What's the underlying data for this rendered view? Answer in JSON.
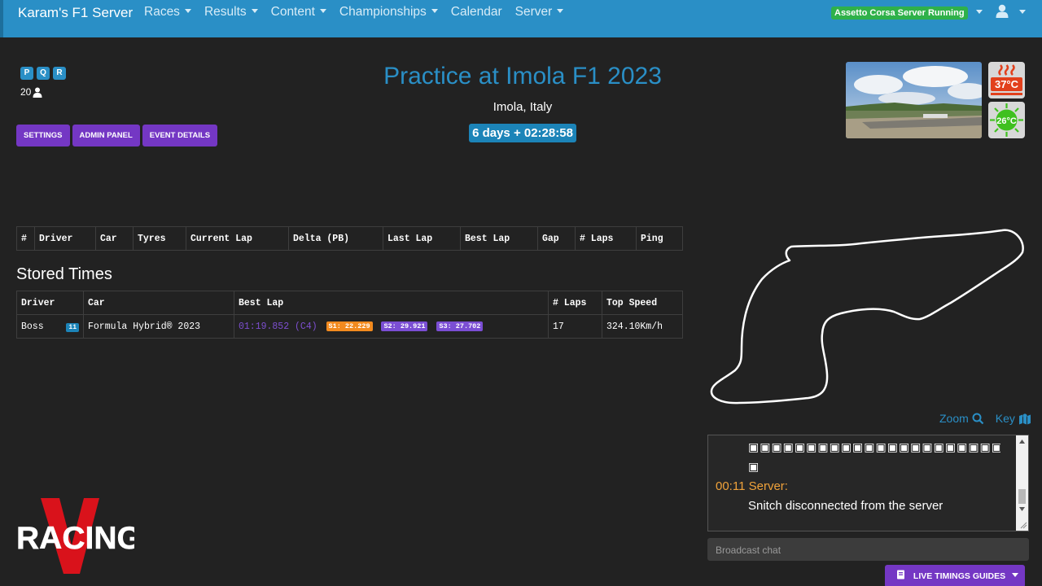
{
  "nav": {
    "brand": "Karam's F1 Server",
    "items": [
      "Races",
      "Results",
      "Content",
      "Championships",
      "Calendar",
      "Server"
    ],
    "dropdown_items": [
      true,
      true,
      true,
      true,
      false,
      true
    ],
    "status": "Assetto Corsa Server Running"
  },
  "session": {
    "badges": [
      "P",
      "Q",
      "R"
    ],
    "driver_count": "20",
    "buttons": [
      "SETTINGS",
      "ADMIN PANEL",
      "EVENT DETAILS"
    ]
  },
  "event": {
    "title": "Practice at Imola F1 2023",
    "location": "Imola, Italy",
    "countdown": "6 days + 02:28:58",
    "road_temp": "37°C",
    "ambient_temp": "26°C"
  },
  "live_table": {
    "headers": [
      "#",
      "Driver",
      "Car",
      "Tyres",
      "Current Lap",
      "Delta (PB)",
      "Last Lap",
      "Best Lap",
      "Gap",
      "# Laps",
      "Ping"
    ]
  },
  "stored": {
    "heading": "Stored Times",
    "headers": [
      "Driver",
      "Car",
      "Best Lap",
      "# Laps",
      "Top Speed"
    ],
    "rows": [
      {
        "driver": "Boss",
        "number": "11",
        "car": "Formula Hybrid® 2023",
        "best_lap": "01:19.852 (C4)",
        "s1": "S1: 22.229",
        "s2": "S2: 29.921",
        "s3": "S3: 27.702",
        "laps": "17",
        "top_speed": "324.10Km/h"
      }
    ]
  },
  "map": {
    "zoom_label": "Zoom",
    "key_label": "Key"
  },
  "chat": {
    "garbled_line_1": "▣▣▣▣▣▣▣▣▣▣▣▣▣▣▣▣▣▣▣▣▣▣▣▣▣▣▣▣▣▣▣▣▣▣▣▣▣▣▣▣▣▣▣▣",
    "garbled_line_2": "▣",
    "time": "00:11",
    "sender": "Server:",
    "message": "Snitch disconnected from the server",
    "placeholder": "Broadcast chat"
  },
  "guides_button": "LIVE TIMINGS GUIDES",
  "logo_text": "RACING"
}
